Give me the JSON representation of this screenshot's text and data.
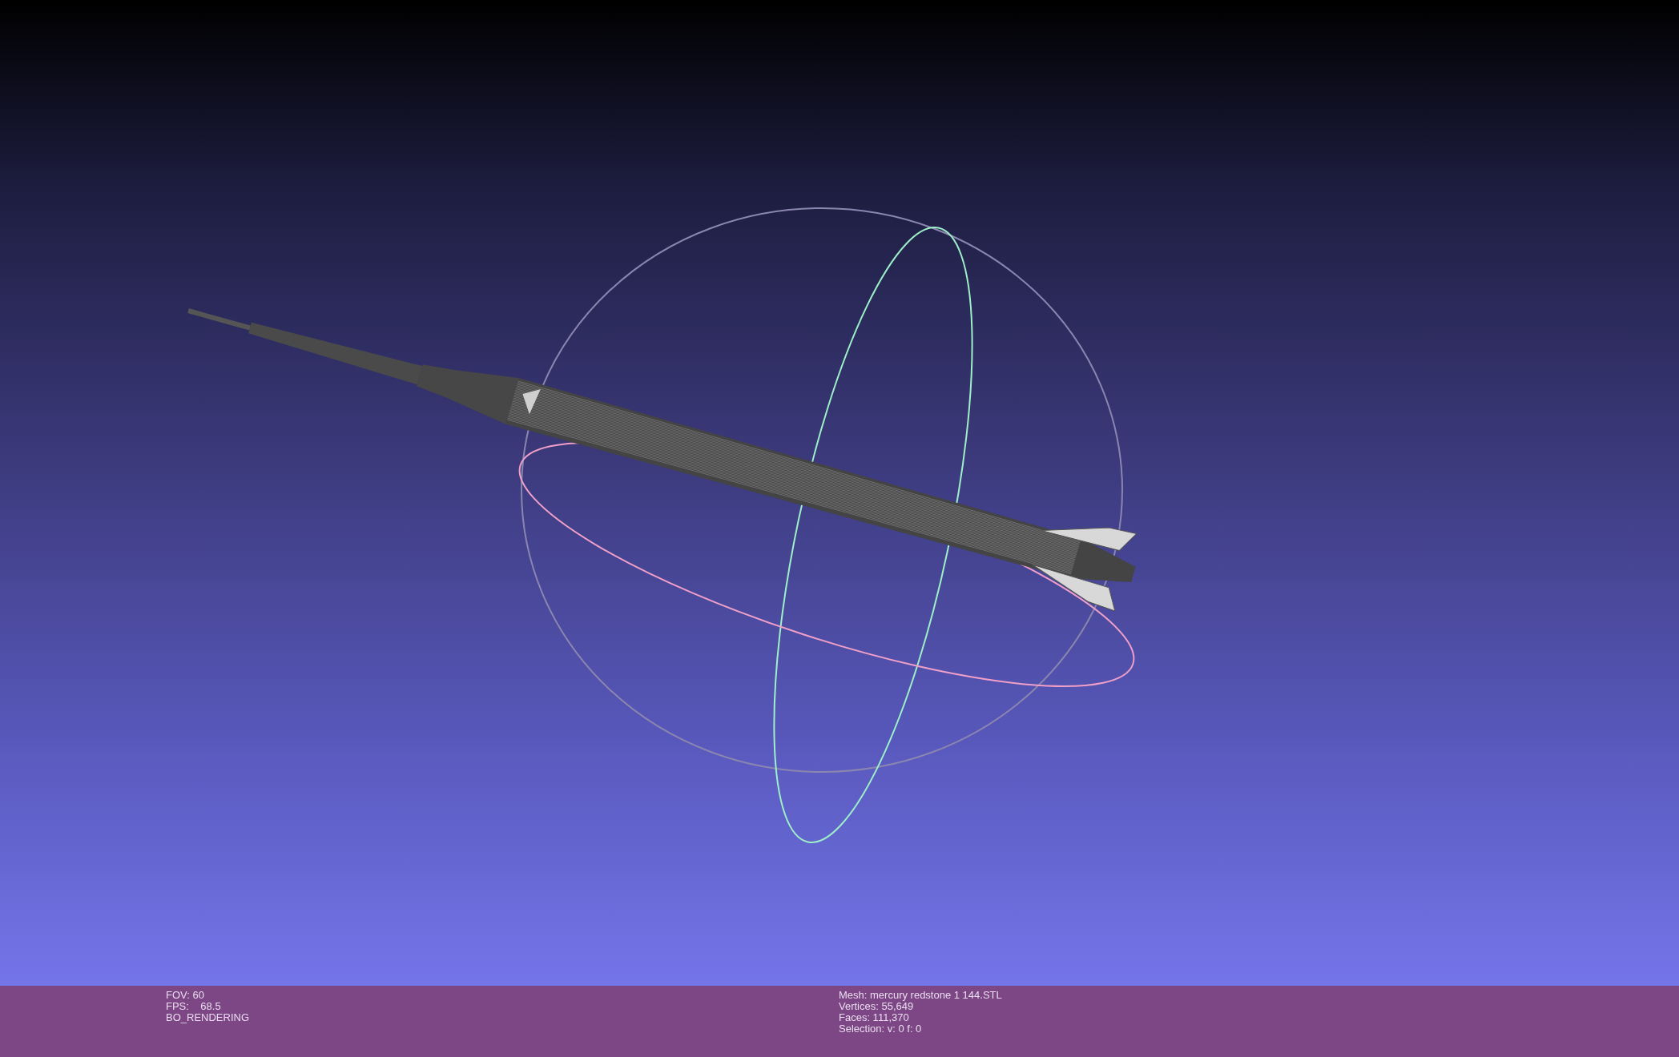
{
  "viewport": {
    "info_left": [
      "FOV: 60",
      "FPS:    68.5",
      "BO_RENDERING"
    ],
    "info_right": [
      "Mesh: mercury redstone 1 144.STL",
      "Vertices: 55,649",
      "Faces: 111,370",
      "Selection: v: 0 f: 0"
    ]
  }
}
